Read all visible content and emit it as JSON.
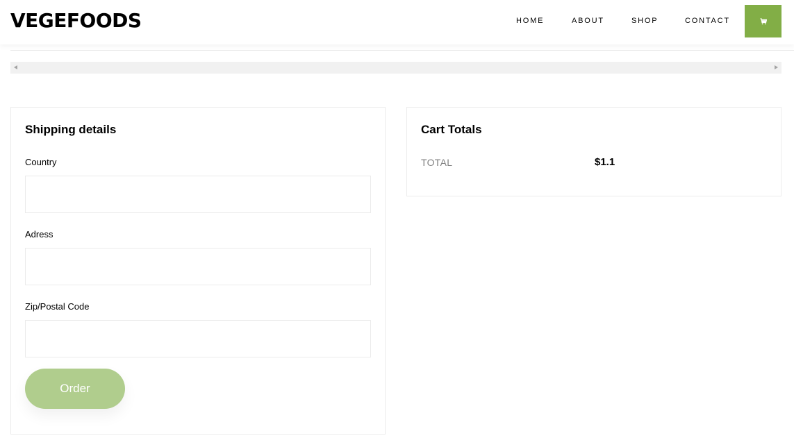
{
  "header": {
    "brand": "VEGEFOODS",
    "nav": {
      "home": "HOME",
      "about": "ABOUT",
      "shop": "SHOP",
      "contact": "CONTACT"
    },
    "cart_icon": "cart-icon",
    "accent_color": "#82ae46"
  },
  "shipping": {
    "title": "Shipping details",
    "country_label": "Country",
    "country_value": "",
    "address_label": "Adress",
    "address_value": "",
    "zip_label": "Zip/Postal Code",
    "zip_value": "",
    "order_label": "Order",
    "order_color": "#b0cd8d"
  },
  "cart_totals": {
    "title": "Cart Totals",
    "total_label": "TOTAL",
    "total_value": "$1.1"
  }
}
